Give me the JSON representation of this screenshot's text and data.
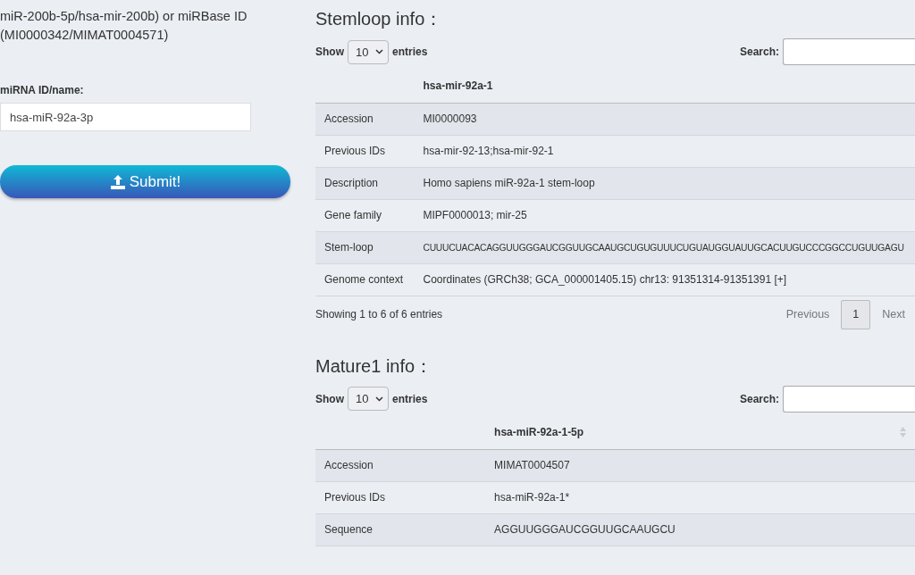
{
  "intro": {
    "lines": [
      "miR-200b-5p/hsa-mir-200b) or miRBase ID",
      "(MI0000342/MIMAT0004571)"
    ]
  },
  "form": {
    "label": "miRNA ID/name:",
    "value": "hsa-miR-92a-3p",
    "submit": "Submit!"
  },
  "sections": [
    {
      "title": "Stemloop info：",
      "show_label": "Show",
      "length": "10",
      "entries_label": "entries",
      "search_label": "Search:",
      "header": "hsa-mir-92a-1",
      "sortable": false,
      "rows": [
        {
          "label": "Accession",
          "value": "MI0000093"
        },
        {
          "label": "Previous IDs",
          "value": "hsa-mir-92-13;hsa-mir-92-1"
        },
        {
          "label": "Description",
          "value": "Homo sapiens miR-92a-1 stem-loop"
        },
        {
          "label": "Gene family",
          "value": "MIPF0000013; mir-25"
        },
        {
          "kind": "sequence",
          "label": "Stem-loop",
          "value": "CUUUCUACACAGGUUGGGAUCGGUUGCAAUGCUGUGUUUCUGUAUGGUAUUGCACUUGUCCCGGCCUGUUGAGU"
        },
        {
          "label": "Genome context",
          "value": "Coordinates (GRCh38; GCA_000001405.15) chr13: 91351314-91351391 [+]"
        }
      ],
      "info": "Showing 1 to 6 of 6 entries",
      "pagination": {
        "previous": "Previous",
        "pages": [
          {
            "label": "1",
            "selected": true
          }
        ],
        "next": "Next"
      }
    },
    {
      "title": "Mature1 info：",
      "show_label": "Show",
      "length": "10",
      "entries_label": "entries",
      "search_label": "Search:",
      "header": "hsa-miR-92a-1-5p",
      "sortable": true,
      "rows": [
        {
          "label": "Accession",
          "value": "MIMAT0004507"
        },
        {
          "label": "Previous IDs",
          "value": "hsa-miR-92a-1*"
        },
        {
          "label": "Sequence",
          "value": "AGGUUGGGAUCGGUUGCAAUGCU"
        }
      ]
    }
  ]
}
